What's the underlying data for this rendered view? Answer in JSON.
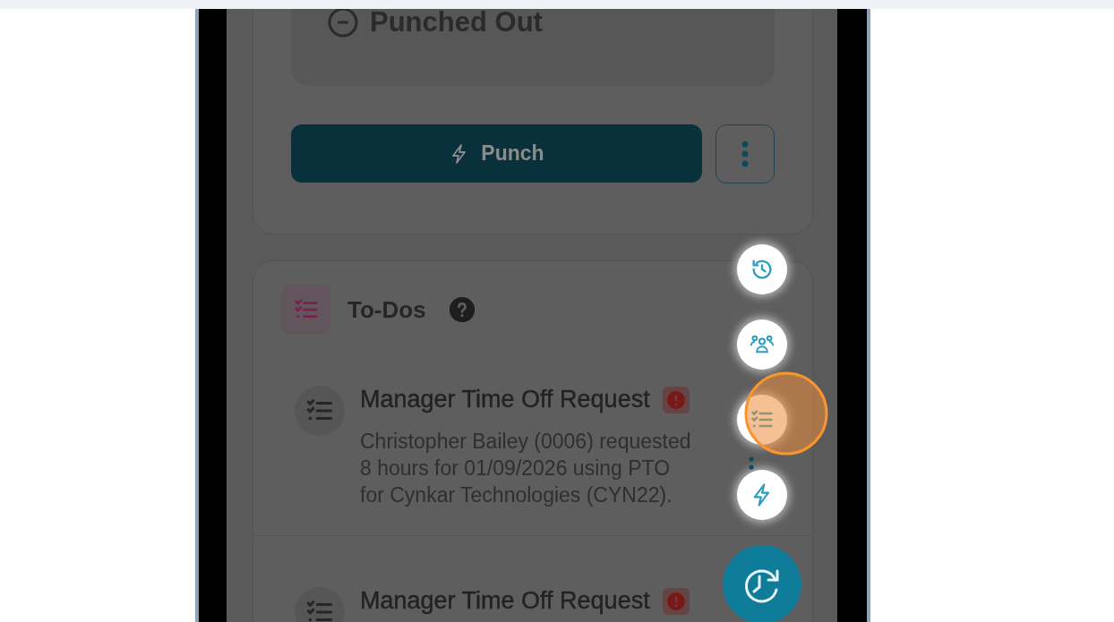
{
  "status": {
    "label": "Punched Out"
  },
  "punch_button": {
    "label": "Punch"
  },
  "todos": {
    "title": "To-Dos",
    "items": [
      {
        "title": "Manager Time Off Request",
        "description": "Christopher Bailey (0006) requested 8 hours for 01/09/2026 using PTO for Cynkar Technologies (CYN22)."
      },
      {
        "title": "Manager Time Off Request"
      }
    ]
  },
  "fab_menu": [
    {
      "kind": "history"
    },
    {
      "kind": "team"
    },
    {
      "kind": "todos"
    },
    {
      "kind": "punch"
    }
  ]
}
